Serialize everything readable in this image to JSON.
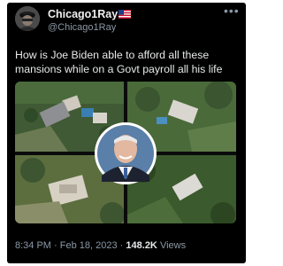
{
  "tweet": {
    "display_name": "Chicago1Ray",
    "handle": "@Chicago1Ray",
    "more_icon": "more-horizontal-icon",
    "text": "How is Joe Biden able to afford all these mansions while on a Govt payroll all his life",
    "time": "8:34 PM",
    "date": "Feb 18, 2023",
    "separator": "·",
    "views_count": "148.2K",
    "views_label": "Views"
  },
  "colors": {
    "background": "#000000",
    "text_primary": "#e7e9ea",
    "text_secondary": "#8b98a5"
  }
}
